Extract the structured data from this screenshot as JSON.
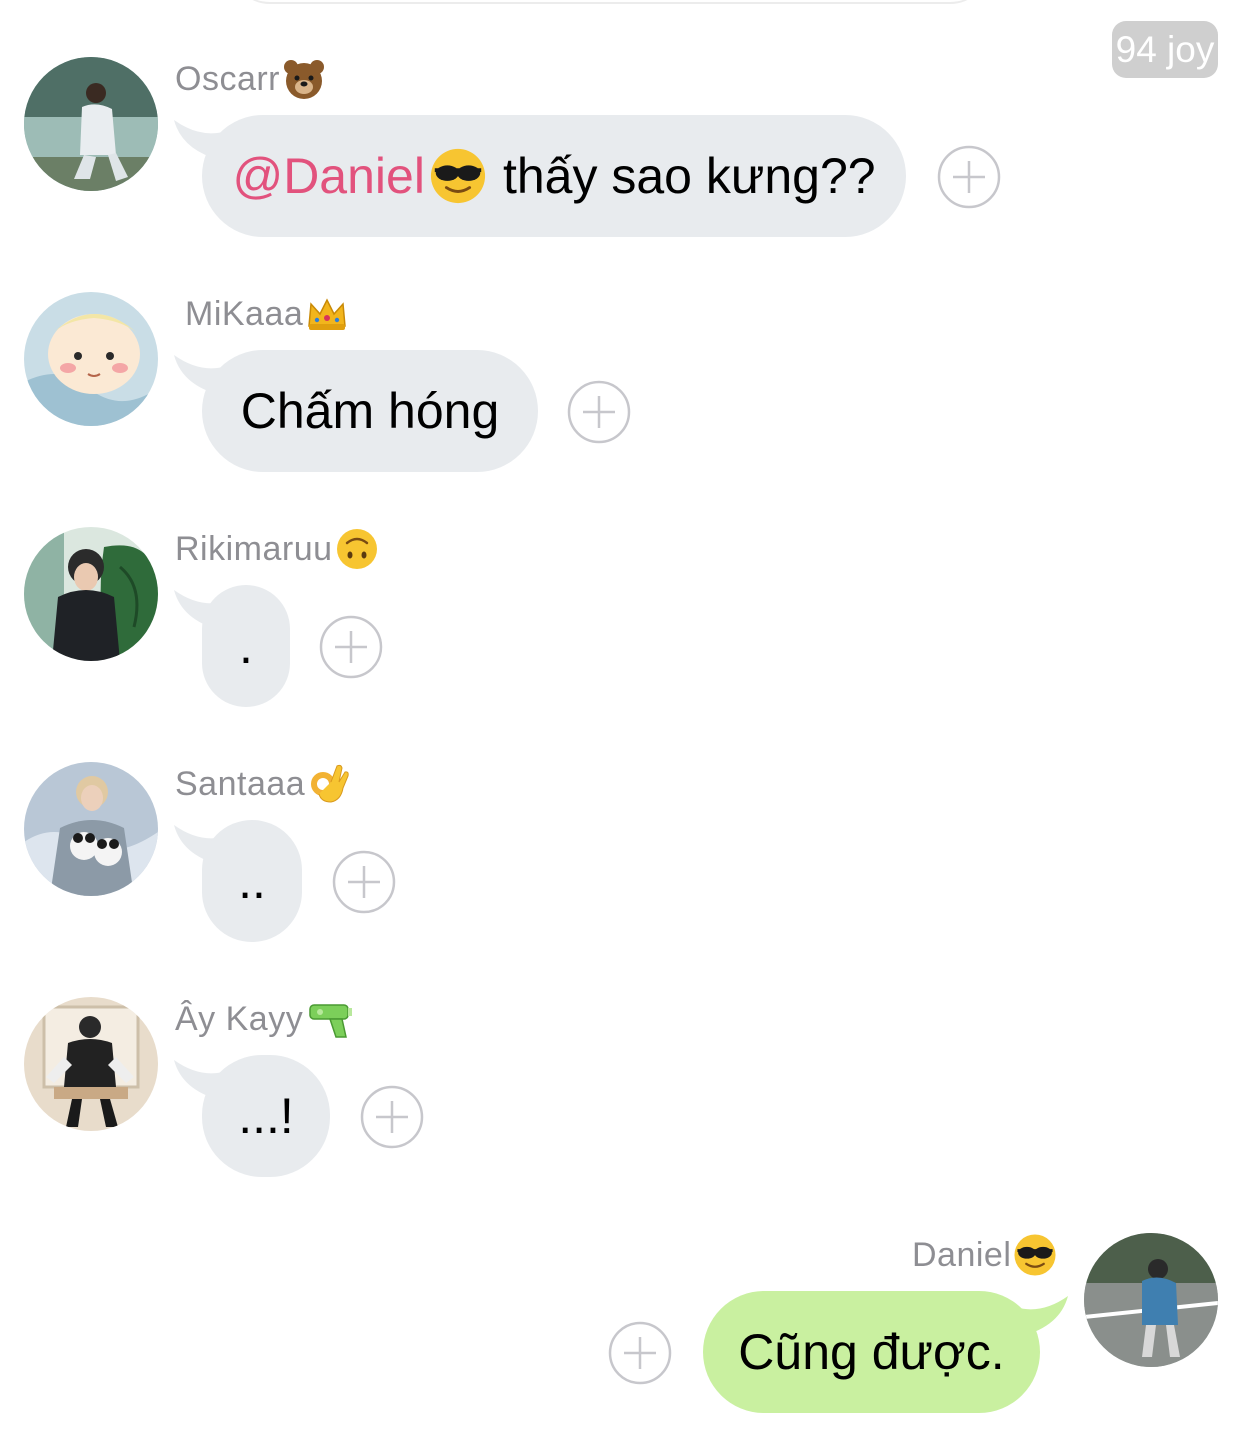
{
  "header": {
    "badge_label": "94 joy"
  },
  "messages": [
    {
      "sender": "Oscarr",
      "sender_emoji": "bear-emoji",
      "mention": "@Daniel",
      "mention_emoji": "sunglasses-emoji",
      "text": "thấy sao kưng??",
      "avatar": "avatar-oscarr"
    },
    {
      "sender": "MiKaaa",
      "sender_emoji": "crown-emoji",
      "text": "Chấm hóng",
      "avatar": "avatar-mikaaa"
    },
    {
      "sender": "Rikimaruu",
      "sender_emoji": "upside-down-face-emoji",
      "text": ".",
      "avatar": "avatar-rikimaruu"
    },
    {
      "sender": "Santaaa",
      "sender_emoji": "ok-hand-emoji",
      "text": "..",
      "avatar": "avatar-santaaa"
    },
    {
      "sender": "Ây Kayy",
      "sender_emoji": "water-pistol-emoji",
      "text": "...!",
      "avatar": "avatar-aykayy"
    },
    {
      "sender": "Daniel",
      "sender_emoji": "sunglasses-emoji",
      "text": "Cũng được.",
      "avatar": "avatar-daniel",
      "outgoing": true
    }
  ],
  "colors": {
    "incoming_bubble": "#e8ebee",
    "outgoing_bubble": "#c9f0a0",
    "mention": "#e2527d",
    "sender_name": "#8e8e93",
    "badge": "#cfcfcf",
    "plus_button": "#c7c7cc"
  },
  "icons": {
    "react": "plus-circle-icon"
  }
}
